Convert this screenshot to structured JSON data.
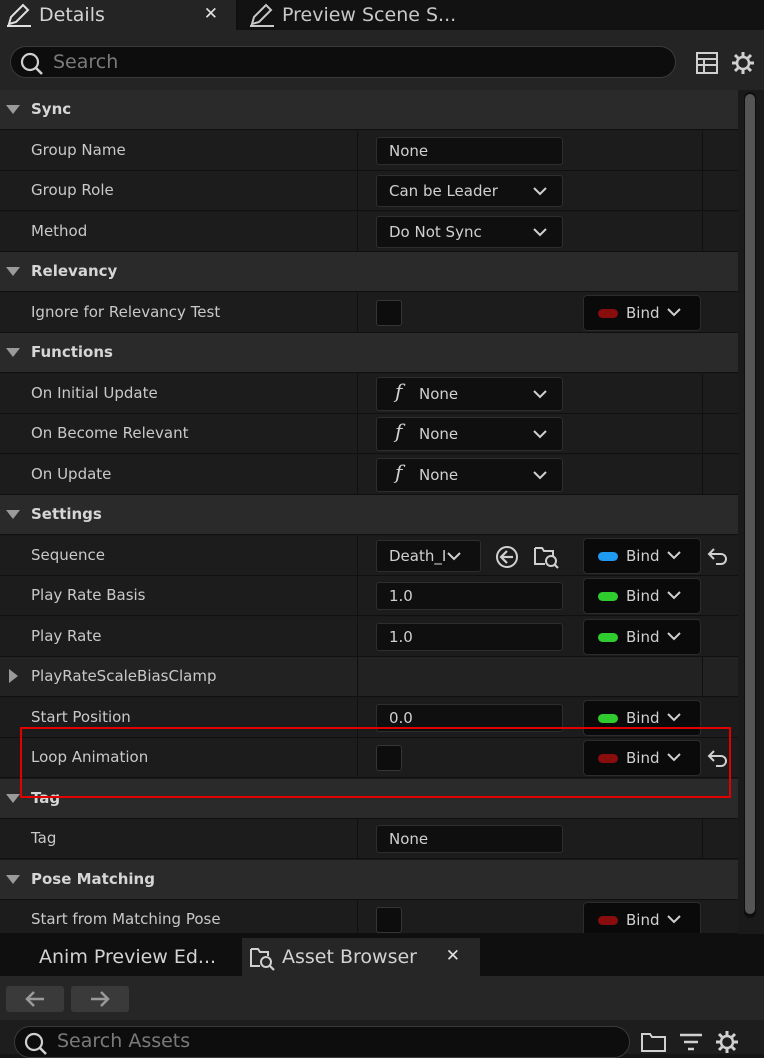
{
  "tabs": {
    "details": "Details",
    "preview": "Preview Scene S..."
  },
  "search": {
    "placeholder": "Search"
  },
  "categories": {
    "sync": "Sync",
    "relevancy": "Relevancy",
    "functions": "Functions",
    "settings": "Settings",
    "tag": "Tag",
    "pose_matching": "Pose Matching"
  },
  "props": {
    "group_name": {
      "label": "Group Name",
      "value": "None"
    },
    "group_role": {
      "label": "Group Role",
      "value": "Can be Leader"
    },
    "method": {
      "label": "Method",
      "value": "Do Not Sync"
    },
    "ignore_relevancy": {
      "label": "Ignore for Relevancy Test",
      "checked": false
    },
    "on_initial_update": {
      "label": "On Initial Update",
      "value": "None"
    },
    "on_become_relevant": {
      "label": "On Become Relevant",
      "value": "None"
    },
    "on_update": {
      "label": "On Update",
      "value": "None"
    },
    "sequence": {
      "label": "Sequence",
      "value": "Death_I"
    },
    "play_rate_basis": {
      "label": "Play Rate Basis",
      "value": "1.0"
    },
    "play_rate": {
      "label": "Play Rate",
      "value": "1.0"
    },
    "play_rate_clamp": {
      "label": "PlayRateScaleBiasClamp"
    },
    "start_position": {
      "label": "Start Position",
      "value": "0.0"
    },
    "loop_animation": {
      "label": "Loop Animation",
      "checked": false
    },
    "tag": {
      "label": "Tag",
      "value": "None"
    },
    "start_matching_pose": {
      "label": "Start from Matching Pose",
      "checked": false
    }
  },
  "bind_label": "Bind",
  "colors": {
    "bind_red": "#8a0d0d",
    "bind_green": "#2ecc2e",
    "bind_blue": "#1e9bf0",
    "highlight": "#e00000"
  },
  "bottom_tabs": {
    "anim_preview": "Anim Preview Ed...",
    "asset_browser": "Asset Browser"
  },
  "asset_search": {
    "placeholder": "Search Assets"
  }
}
